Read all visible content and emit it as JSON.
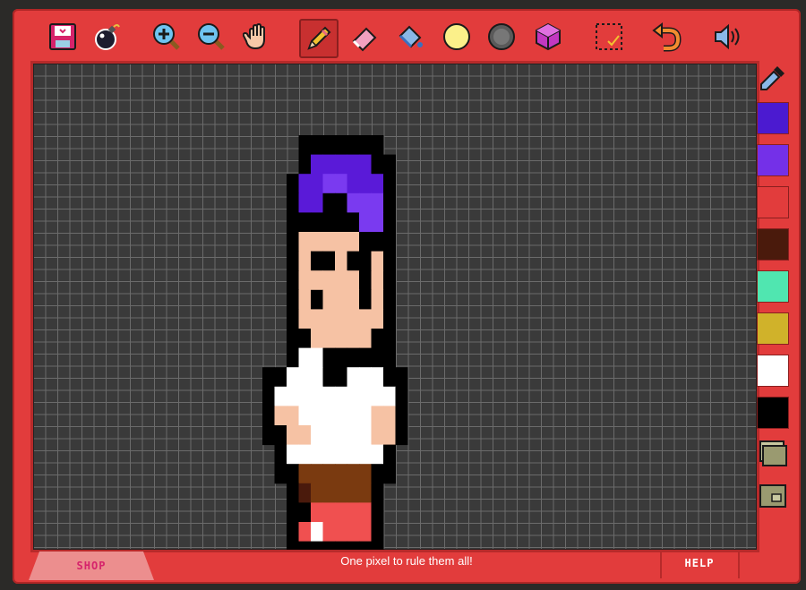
{
  "toolbar": {
    "tools": [
      {
        "id": "save",
        "icon": "floppy-disk-icon"
      },
      {
        "id": "clear",
        "icon": "bomb-icon"
      },
      {
        "id": "zoom-in",
        "icon": "zoom-in-icon"
      },
      {
        "id": "zoom-out",
        "icon": "zoom-out-icon"
      },
      {
        "id": "pan",
        "icon": "hand-icon"
      },
      {
        "id": "pencil",
        "icon": "pencil-icon",
        "selected": true
      },
      {
        "id": "eraser",
        "icon": "eraser-icon"
      },
      {
        "id": "fill",
        "icon": "paint-bucket-icon"
      },
      {
        "id": "light",
        "icon": "light-circle-icon"
      },
      {
        "id": "dark",
        "icon": "dark-circle-icon"
      },
      {
        "id": "cube",
        "icon": "cube-icon"
      },
      {
        "id": "select",
        "icon": "selection-icon"
      },
      {
        "id": "undo",
        "icon": "undo-icon"
      },
      {
        "id": "sound",
        "icon": "speaker-icon"
      }
    ]
  },
  "palette": {
    "picker_icon": "eyedropper-icon",
    "colors": [
      "#4b1ad0",
      "#7430e8",
      "#e23c3c",
      "#4a1a0c",
      "#50e6b0",
      "#d0b22a",
      "#ffffff",
      "#000000"
    ],
    "extra_icons": [
      "layers-icon",
      "frame-icon"
    ]
  },
  "footer": {
    "shop_label": "SHOP",
    "message": "One pixel to rule them all!",
    "help_label": "HELP"
  },
  "colors": {
    "frame": "#e23c3c",
    "grid_bg": "#3a3a3a",
    "shop_tab": "#ec8e8e",
    "shop_text": "#d6236b"
  }
}
